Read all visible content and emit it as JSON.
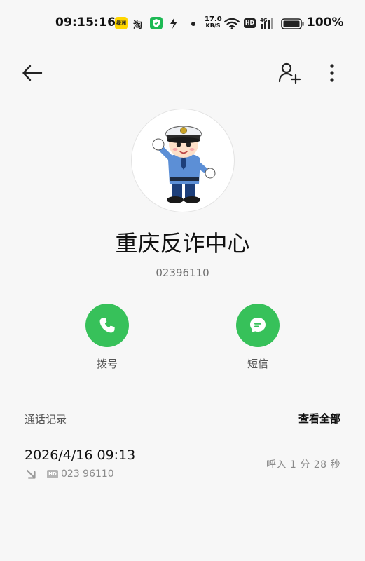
{
  "status_bar": {
    "time": "09:15:16",
    "app_badge_1": "绿洲",
    "app_badge_2": "淘",
    "net_speed_value": "17.0",
    "net_speed_unit": "KB/S",
    "hd": "HD",
    "network_type": "4G",
    "battery_percent": "100%"
  },
  "contact": {
    "name": "重庆反诈中心",
    "number": "02396110"
  },
  "actions": {
    "call_label": "拨号",
    "sms_label": "短信"
  },
  "call_log": {
    "title": "通话记录",
    "view_all": "查看全部",
    "entries": [
      {
        "datetime": "2026/4/16 09:13",
        "hd": "HD",
        "number": "023 96110",
        "duration": "呼入 1 分 28 秒",
        "direction": "incoming"
      }
    ]
  },
  "colors": {
    "accent_green": "#37c15a",
    "background": "#f7f7f7"
  }
}
